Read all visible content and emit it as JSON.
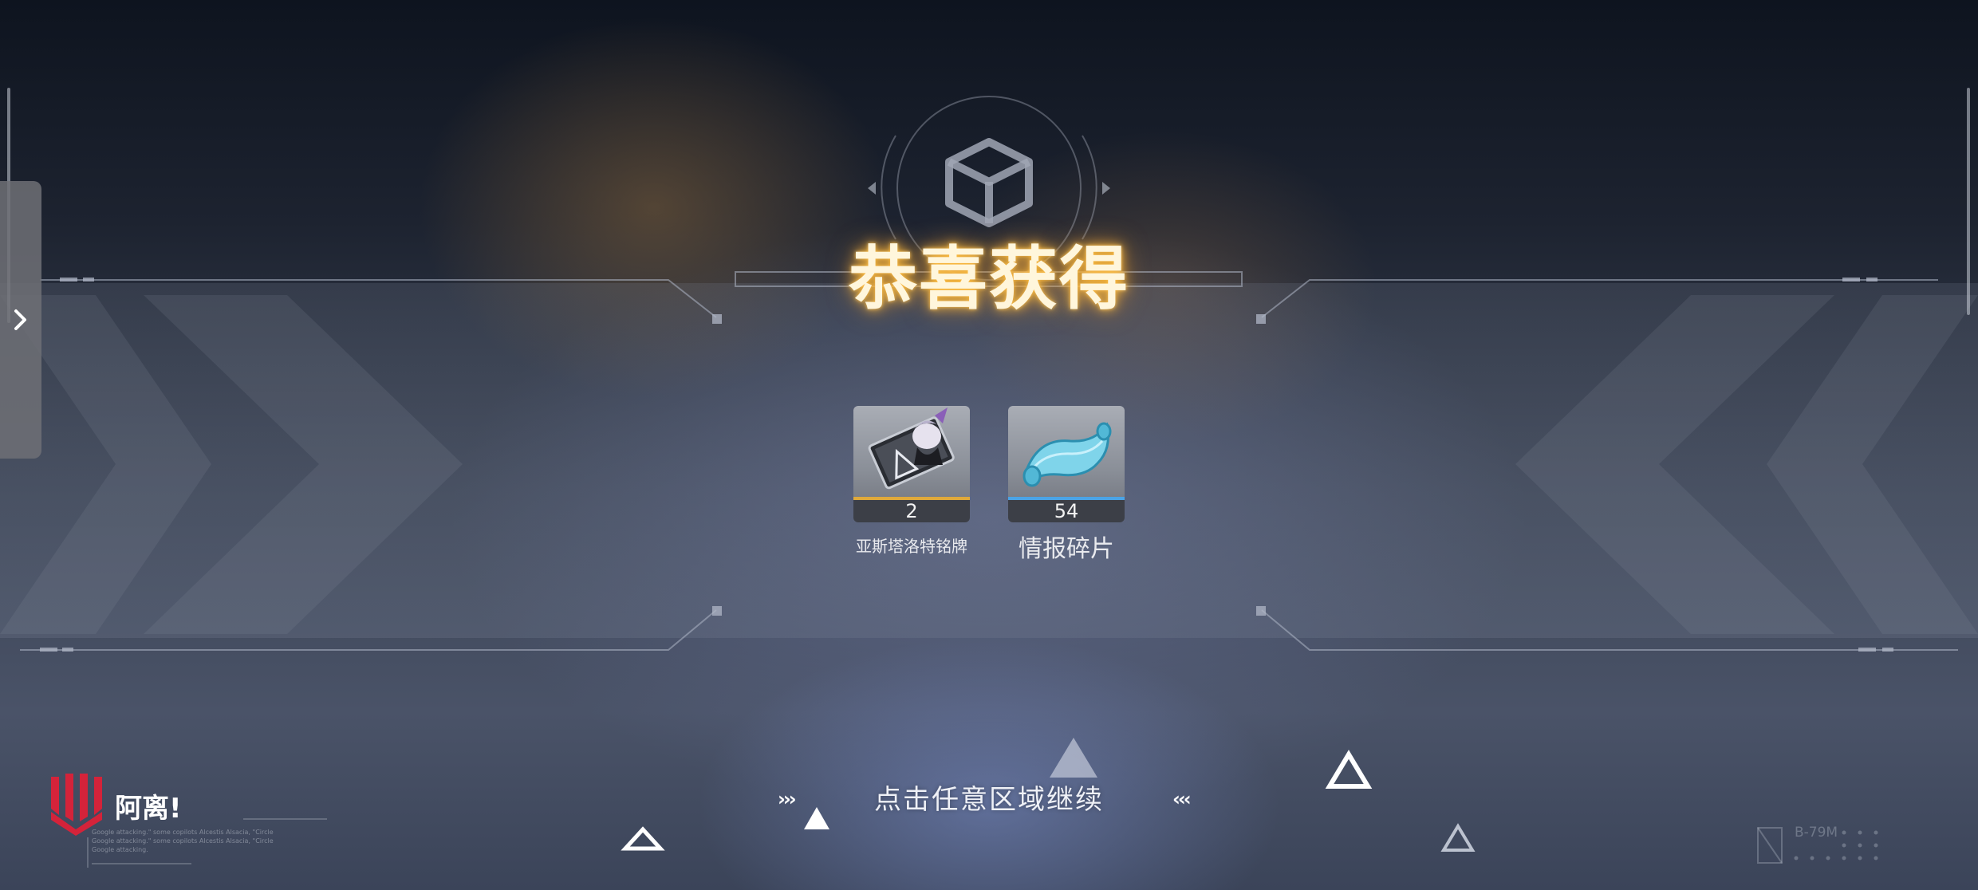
{
  "title": "恭喜获得",
  "rewards": [
    {
      "name": "亚斯塔洛特铭牌",
      "count": "2",
      "rarity_color": "#e0a93a"
    },
    {
      "name": "情报碎片",
      "count": "54",
      "rarity_color": "#4aa3e6"
    }
  ],
  "continue_prompt": "点击任意区域继续",
  "continue_arrows_left": "›››",
  "continue_arrows_right": "‹‹‹",
  "player": {
    "name": "阿离!"
  },
  "overlay_text": [
    "Google attacking.\" some copilots Alcestis Alsacia, \"Circle",
    "Google attacking.\" some copilots Alcestis Alsacia, \"Circle",
    "Google attacking."
  ],
  "version_label": "B-79M",
  "colors": {
    "title_glow": "#ffb53c",
    "brand_red": "#d4233a",
    "panel_line": "#9aa2b2"
  },
  "icons": [
    "chevron-right-icon",
    "crate-icon",
    "brand-logo-icon",
    "triangle-icon",
    "nameplate-icon",
    "scroll-fragment-icon"
  ]
}
